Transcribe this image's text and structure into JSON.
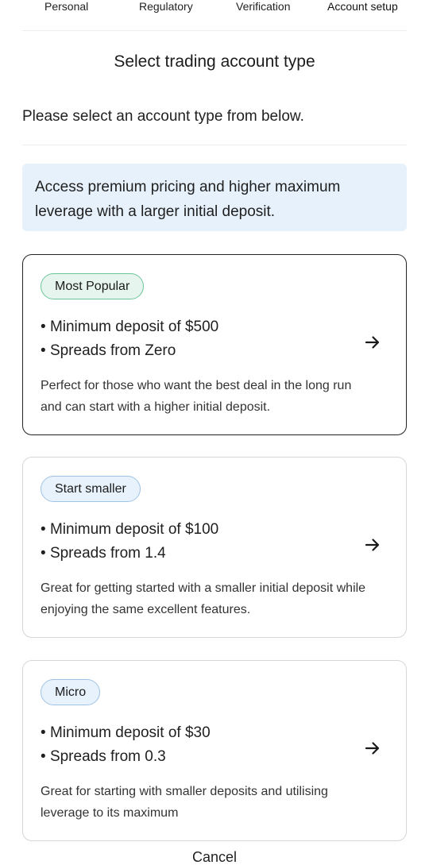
{
  "stepper": {
    "steps": [
      "Personal",
      "Regulatory",
      "Verification",
      "Account setup"
    ],
    "active_index": 3
  },
  "page": {
    "title": "Select trading account type",
    "subtitle": "Please select an account type from below."
  },
  "info_banner": {
    "text": "Access premium pricing and higher maximum leverage with a larger initial deposit."
  },
  "accounts": [
    {
      "badge": "Most Popular",
      "bullets": [
        "Minimum deposit of $500",
        "Spreads from Zero"
      ],
      "description": "Perfect for those who want the best deal in the long run and can start with a higher initial deposit.",
      "selected": true
    },
    {
      "badge": "Start smaller",
      "bullets": [
        "Minimum deposit of $100",
        "Spreads from 1.4"
      ],
      "description": "Great for getting started with a smaller initial deposit while enjoying the same excellent features.",
      "selected": false
    },
    {
      "badge": "Micro",
      "bullets": [
        "Minimum deposit of $30",
        "Spreads from 0.3"
      ],
      "description": "Great for starting with smaller deposits and utilising leverage to its maximum",
      "selected": false
    }
  ],
  "footer": {
    "cancel_label": "Cancel"
  },
  "colors": {
    "banner_bg": "#e6f1fb",
    "popular_badge_border": "#6cc59a",
    "badge_border": "#9fc3e4",
    "selected_border": "#222222"
  },
  "icons": {
    "card_arrow": "arrow-right-icon"
  }
}
